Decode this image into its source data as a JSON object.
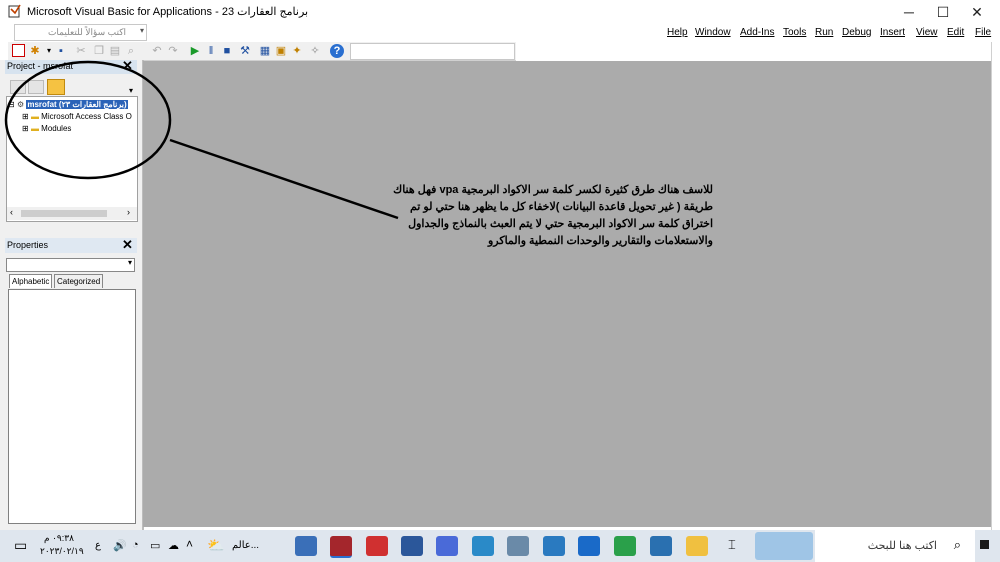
{
  "window": {
    "title": "Microsoft Visual Basic for Applications - برنامج العقارات 23"
  },
  "window_controls": {
    "minimize": "─",
    "maximize": "☐",
    "close": "✕"
  },
  "menu": {
    "items": [
      "Help",
      "Window",
      "Add-Ins",
      "Tools",
      "Run",
      "Debug",
      "Insert",
      "View",
      "Edit",
      "File"
    ],
    "ask_placeholder": "اكتب سؤالاً للتعليمات"
  },
  "project_pane": {
    "title": "Project - msrofat",
    "root": "msrofat (برنامج العقارات ٢٣)",
    "nodes": [
      "Microsoft Access Class O",
      "Modules"
    ]
  },
  "properties_pane": {
    "title": "Properties",
    "tabs": [
      "Alphabetic",
      "Categorized"
    ]
  },
  "annotation": {
    "text": "للاسف هناك طرق كثيرة لكسر كلمة سر الاكواد البرمجية vpa فهل هناك طريقة ( غير تحويل قاعدة البيانات )لاخفاء كل ما يظهر هنا حتي لو تم اختراق كلمة سر الاكواد البرمجية حتي لا يتم العبث بالنماذج والجداول والاستعلامات والتقارير والوحدات النمطية والماكرو",
    "circle_color": "#000000"
  },
  "taskbar": {
    "search_placeholder": "اكتب هنا للبحث",
    "time": "٠٩:٣٨ م",
    "date": "٢٠٢٣/٠٢/١٩",
    "language": "ع",
    "weather": "عالم...",
    "app_icons": [
      "task-view-icon",
      "access-icon",
      "wps-icon",
      "word-icon",
      "edge-icon",
      "terminal-icon",
      "settings-icon",
      "calculator-icon",
      "mail-icon",
      "chrome-icon",
      "store-icon",
      "explorer-icon"
    ]
  }
}
